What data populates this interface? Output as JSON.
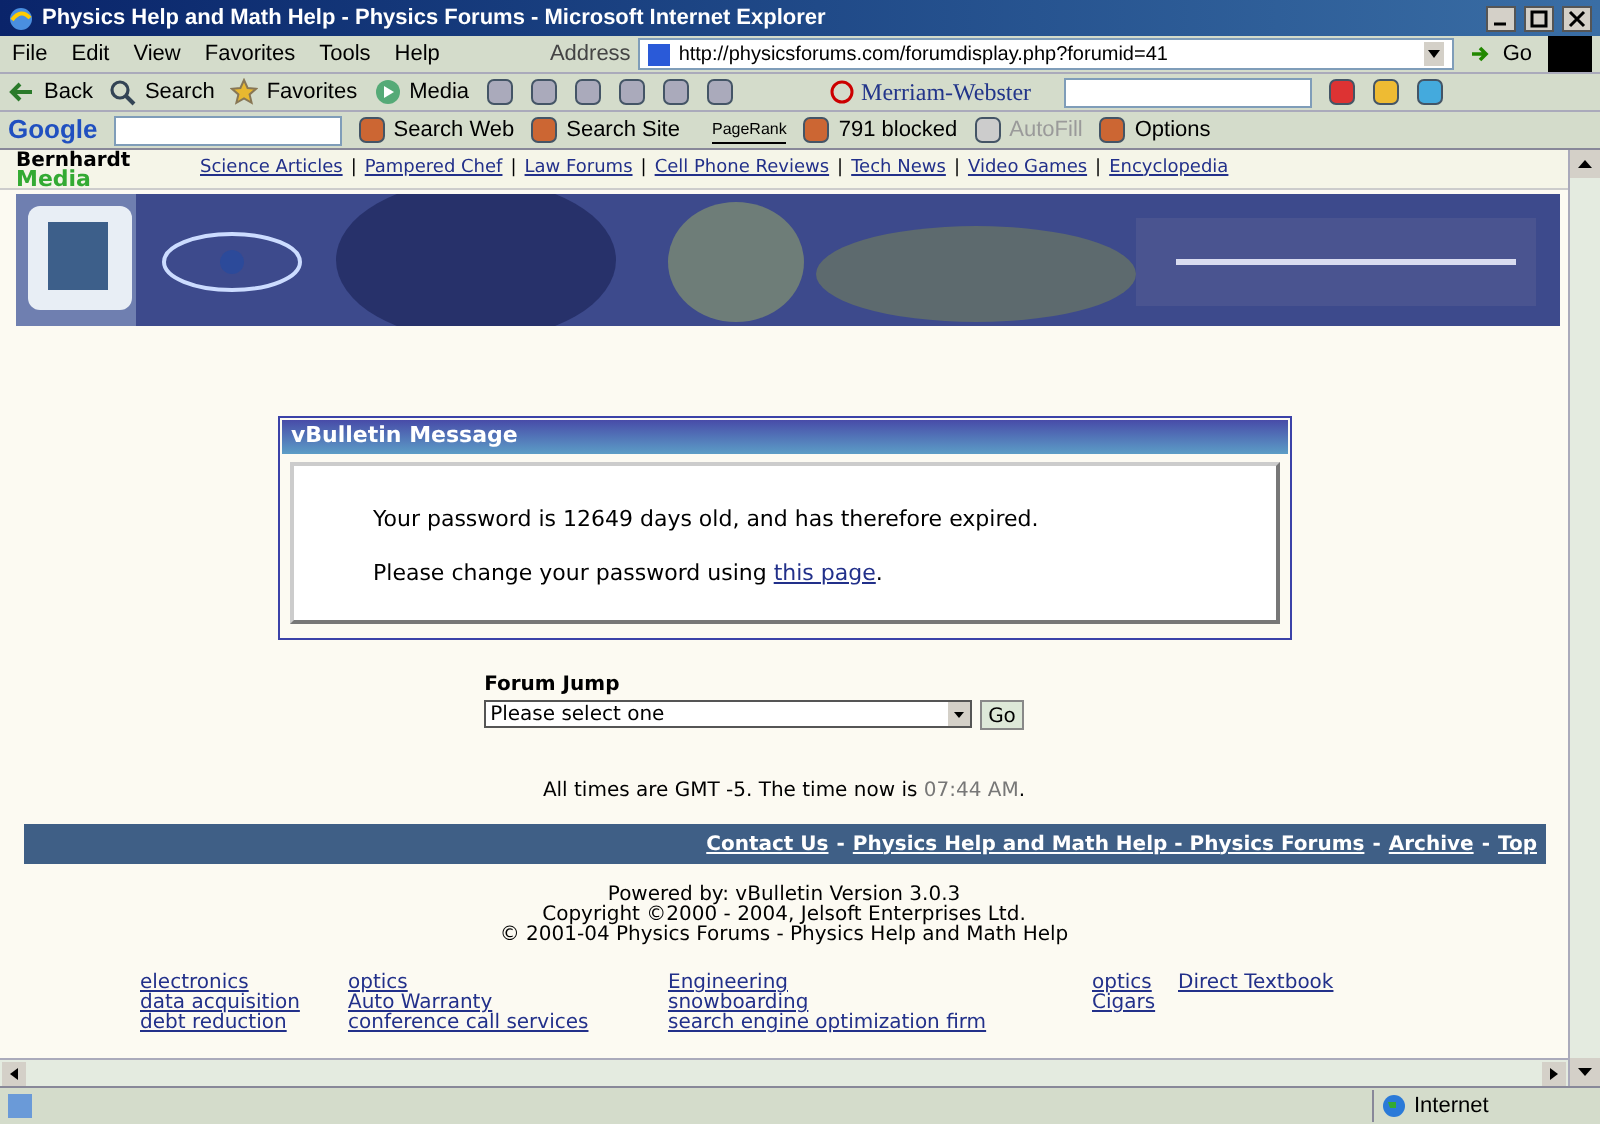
{
  "window": {
    "title": "Physics Help and Math Help - Physics Forums - Microsoft Internet Explorer"
  },
  "menu": [
    "File",
    "Edit",
    "View",
    "Favorites",
    "Tools",
    "Help"
  ],
  "address": {
    "label": "Address",
    "url": "http://physicsforums.com/forumdisplay.php?forumid=41",
    "go": "Go"
  },
  "toolbar": {
    "buttons": [
      {
        "kind": "back",
        "label": "Back"
      },
      {
        "kind": "search",
        "label": "Search"
      },
      {
        "kind": "favorites",
        "label": "Favorites"
      },
      {
        "kind": "media",
        "label": "Media"
      }
    ],
    "dictionary": "Merriam-Webster"
  },
  "google_bar": {
    "brand": "Google",
    "buttons": [
      {
        "label": "Search Web",
        "disabled": false
      },
      {
        "label": "Search Site",
        "disabled": false
      },
      {
        "label": "791 blocked",
        "disabled": false
      },
      {
        "label": "AutoFill",
        "disabled": true
      },
      {
        "label": "Options",
        "disabled": false
      }
    ],
    "pagerank": "PageRank"
  },
  "site": {
    "logo_top": "Bernhardt",
    "logo_bottom": "Media",
    "links": [
      "Science Articles",
      "Pampered Chef",
      "Law Forums",
      "Cell Phone Reviews",
      "Tech News",
      "Video Games",
      "Encyclopedia"
    ],
    "separator": "|"
  },
  "message": {
    "title": "vBulletin Message",
    "line1": "Your password is 12649 days old, and has therefore expired.",
    "line2_before": "Please change your password using",
    "link": "this page",
    "line2_after": "."
  },
  "forum_jump": {
    "label": "Forum Jump",
    "value": "Please select one",
    "go": "Go"
  },
  "times": {
    "before": "All times are GMT -5. The time now is",
    "time": "07:44 AM",
    "after": "."
  },
  "footer_links": [
    "Contact Us",
    "Physics Help and Math Help - Physics Forums",
    "Archive",
    "Top"
  ],
  "footer_separator": "-",
  "credits": [
    "Powered by: vBulletin Version 3.0.3",
    "Copyright ©2000 - 2004, Jelsoft Enterprises Ltd.",
    "© 2001-04 Physics Forums - Physics Help and Math Help"
  ],
  "ad_columns": [
    [
      "electronics",
      "data acquisition",
      "debt reduction"
    ],
    [
      "optics",
      "Auto Warranty",
      "conference call services"
    ],
    [
      "Engineering",
      "snowboarding",
      "search engine optimization firm"
    ],
    [
      "optics",
      "Cigars"
    ],
    [
      "Direct Textbook"
    ]
  ],
  "status_bar": {
    "zone": "Internet"
  }
}
